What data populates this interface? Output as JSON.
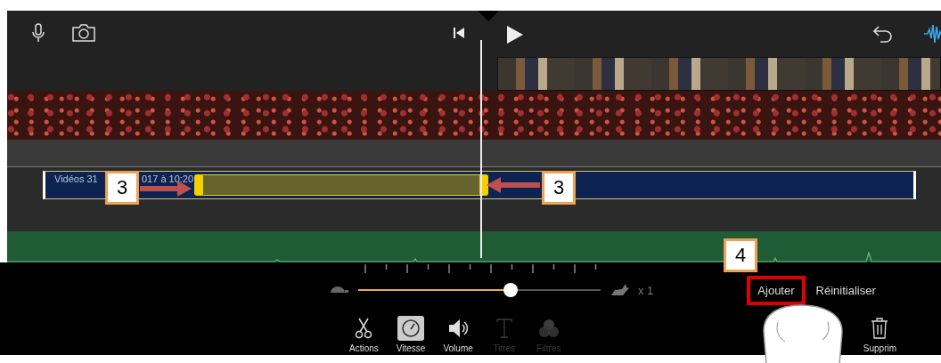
{
  "clip": {
    "label_parts": [
      "Vidéos 31",
      "017 à 10:20"
    ]
  },
  "annotations": [
    {
      "label": "3",
      "kind": "arrow-right"
    },
    {
      "label": "3",
      "kind": "arrow-left"
    },
    {
      "label": "4",
      "kind": "plain"
    }
  ],
  "speed": {
    "level": 0.63,
    "reading": "x 1"
  },
  "actions": [
    {
      "label": "Ajouter",
      "highlighted": true
    },
    {
      "label": "Réinitialiser",
      "highlighted": false
    }
  ],
  "tools": [
    {
      "label": "Actions",
      "kind": "scissors",
      "selected": false,
      "disabled": false
    },
    {
      "label": "Vitesse",
      "kind": "gauge",
      "selected": true,
      "disabled": false
    },
    {
      "label": "Volume",
      "kind": "speaker",
      "selected": false,
      "disabled": false
    },
    {
      "label": "Titres",
      "kind": "text",
      "selected": false,
      "disabled": true
    },
    {
      "label": "Filtres",
      "kind": "filters",
      "selected": false,
      "disabled": true
    },
    {
      "label": "Supprim",
      "kind": "trash",
      "selected": false,
      "disabled": false
    }
  ]
}
